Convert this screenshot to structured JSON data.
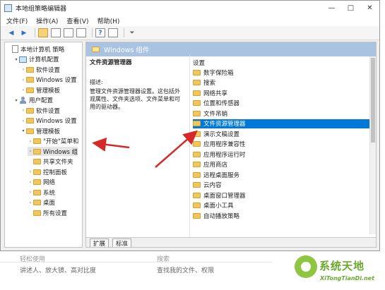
{
  "window": {
    "title": "本地组策略编辑器",
    "controls": [
      "—",
      "□",
      "✕"
    ]
  },
  "menu": [
    "文件(F)",
    "操作(A)",
    "查看(V)",
    "帮助(H)"
  ],
  "tree": [
    {
      "label": "本地计算机 策略",
      "indent": 0,
      "icon": "doc-icon",
      "twisty": ""
    },
    {
      "label": "计算机配置",
      "indent": 1,
      "icon": "computer-icon",
      "twisty": "▾"
    },
    {
      "label": "软件设置",
      "indent": 2,
      "icon": "folder-icon",
      "twisty": "›"
    },
    {
      "label": "Windows 设置",
      "indent": 2,
      "icon": "folder-icon",
      "twisty": "›"
    },
    {
      "label": "管理模板",
      "indent": 2,
      "icon": "folder-icon",
      "twisty": "›"
    },
    {
      "label": "用户配置",
      "indent": 1,
      "icon": "user-icon",
      "twisty": "▾"
    },
    {
      "label": "软件设置",
      "indent": 2,
      "icon": "folder-icon",
      "twisty": "›"
    },
    {
      "label": "Windows 设置",
      "indent": 2,
      "icon": "folder-icon",
      "twisty": "›"
    },
    {
      "label": "管理模板",
      "indent": 2,
      "icon": "folder-icon",
      "twisty": "▾"
    },
    {
      "label": "\"开始\"菜单和",
      "indent": 3,
      "icon": "folder-icon",
      "twisty": "›"
    },
    {
      "label": "Windows 组",
      "indent": 3,
      "icon": "folder-icon",
      "twisty": "›",
      "selected": true
    },
    {
      "label": "共享文件夹",
      "indent": 3,
      "icon": "folder-icon",
      "twisty": ""
    },
    {
      "label": "控制面板",
      "indent": 3,
      "icon": "folder-icon",
      "twisty": "›"
    },
    {
      "label": "网络",
      "indent": 3,
      "icon": "folder-icon",
      "twisty": "›"
    },
    {
      "label": "系统",
      "indent": 3,
      "icon": "folder-icon",
      "twisty": "›"
    },
    {
      "label": "桌面",
      "indent": 3,
      "icon": "folder-icon",
      "twisty": "›"
    },
    {
      "label": "所有设置",
      "indent": 3,
      "icon": "folder-icon",
      "twisty": ""
    }
  ],
  "right": {
    "header": "Windows 组件",
    "desc_title": "文件资源管理器",
    "desc_label": "描述:",
    "desc_text": "管理文件资源管理器设置。这包括外观属性、文件夹选项、文件菜单和可用的驱动器。",
    "list_header": "设置",
    "items": [
      "数字保险箱",
      "搜索",
      "网络共享",
      "位置和传感器",
      "文件吊销",
      "文件资源管理器",
      "演示文稿设置",
      "应用程序兼容性",
      "应用程序运行时",
      "应用商店",
      "远程桌面服务",
      "云内容",
      "桌面窗口管理器",
      "桌面小工具",
      "自动播放策略"
    ],
    "selected_index": 5,
    "tabs": [
      "扩展",
      "标准"
    ]
  },
  "below": {
    "left_title": "轻松使用",
    "left_text": "讲述人、放大镜、高对比度",
    "right_title": "搜索",
    "right_text": "查找我的文件、权限"
  },
  "watermark": {
    "text": "系统天地",
    "sub": "XiTongTianDi.net"
  },
  "colors": {
    "selection": "#0078d7",
    "header_band": "#a9c3e1",
    "annotation_arrow": "#d62828"
  }
}
